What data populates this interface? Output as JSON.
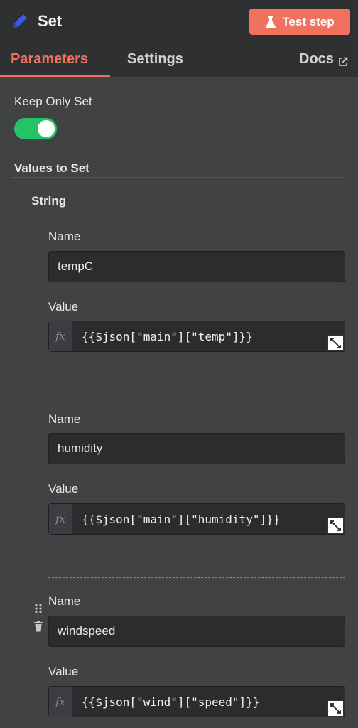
{
  "header": {
    "title": "Set",
    "test_button_label": "Test step",
    "tabs": {
      "parameters": "Parameters",
      "settings": "Settings",
      "docs": "Docs"
    }
  },
  "params": {
    "keep_only_set_label": "Keep Only Set",
    "keep_only_set": true,
    "values_to_set_label": "Values to Set",
    "string_label": "String",
    "fields": [
      {
        "name_label": "Name",
        "name": "tempC",
        "value_label": "Value",
        "value": "{{$json[\"main\"][\"temp\"]}}"
      },
      {
        "name_label": "Name",
        "name": "humidity",
        "value_label": "Value",
        "value": "{{$json[\"main\"][\"humidity\"]}}"
      },
      {
        "name_label": "Name",
        "name": "windspeed",
        "value_label": "Value",
        "value": "{{$json[\"wind\"][\"speed\"]}}"
      }
    ],
    "fx_label": "fx"
  },
  "colors": {
    "accent": "#f0715e",
    "toggle_on": "#24c365",
    "header_bg": "#2f3032",
    "panel_bg": "#414244"
  },
  "icons": {
    "title": "pencil-icon",
    "test": "flask-icon",
    "docs": "external-link-icon",
    "expand": "expand-icon",
    "drag": "drag-handle-icon",
    "delete": "trash-icon"
  }
}
